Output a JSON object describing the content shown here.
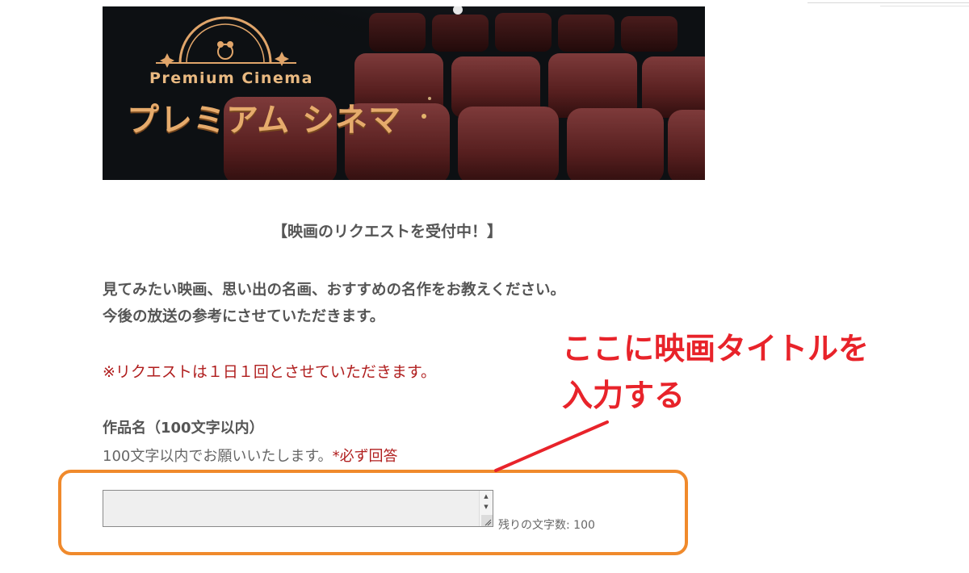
{
  "banner": {
    "logo_en": "Premium Cinema",
    "logo_ja": "プレミアム シネマ",
    "logo_color": "#e9b981"
  },
  "heading": "【映画のリクエストを受付中！】",
  "intro": {
    "line1": "見てみたい映画、思い出の名画、おすすめの名作をお教えください。",
    "line2": "今後の放送の参考にさせていただきます。"
  },
  "notice": "※リクエストは１日１回とさせていただきます。",
  "field": {
    "label": "作品名（100文字以内）",
    "help": "100文字以内でお願いいたします。",
    "required": "*必ず回答",
    "value": "",
    "counter": "残りの文字数: 100"
  },
  "annotation": {
    "line1": "ここに映画タイトルを",
    "line2": "入力する",
    "text_color": "#e8232a",
    "frame_color": "#f08a2c"
  },
  "icons": {
    "scroll_up": "scroll-up-arrow-icon",
    "scroll_down": "scroll-down-arrow-icon",
    "resize": "resize-grip-icon"
  }
}
